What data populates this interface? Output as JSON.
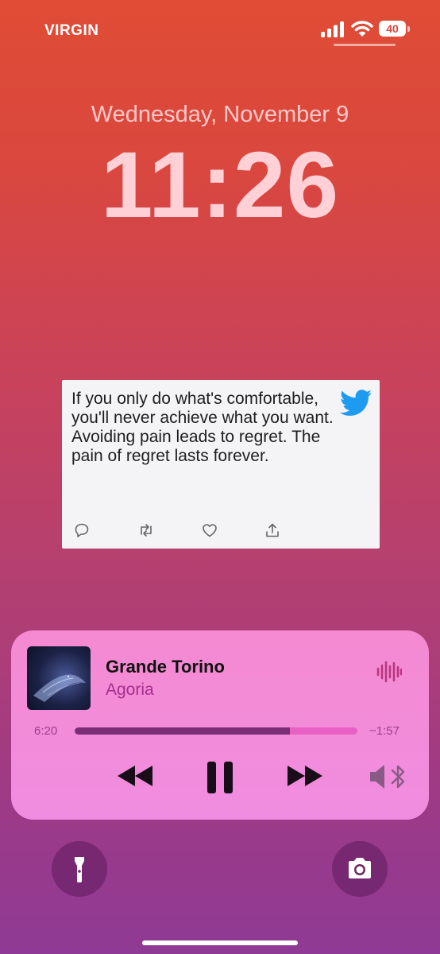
{
  "status_bar": {
    "carrier": "VIRGIN",
    "battery": "40"
  },
  "lock": {
    "date": "Wednesday, November 9",
    "time": "11:26"
  },
  "tweet_widget": {
    "text": "If you only do what's comfortable, you'll never achieve what you want. Avoiding pain leads to regret. The pain of regret lasts forever.",
    "actions": [
      "reply-icon",
      "retweet-icon",
      "like-icon",
      "share-icon"
    ],
    "brand_color": "#1d9bf0"
  },
  "now_playing": {
    "title": "Grande Torino",
    "artist": "Agoria",
    "elapsed": "6:20",
    "remaining": "−1:57",
    "progress": 0.76,
    "icons": [
      "rewind-icon",
      "pause-icon",
      "fast-forward-icon",
      "speaker-bluetooth-icon",
      "waveform-icon"
    ]
  },
  "quick_actions": [
    "flashlight-icon",
    "camera-icon"
  ],
  "colors": {
    "accent": "#f58ad1",
    "artist": "#a52f8f",
    "progress_fill": "#7b2e76"
  }
}
